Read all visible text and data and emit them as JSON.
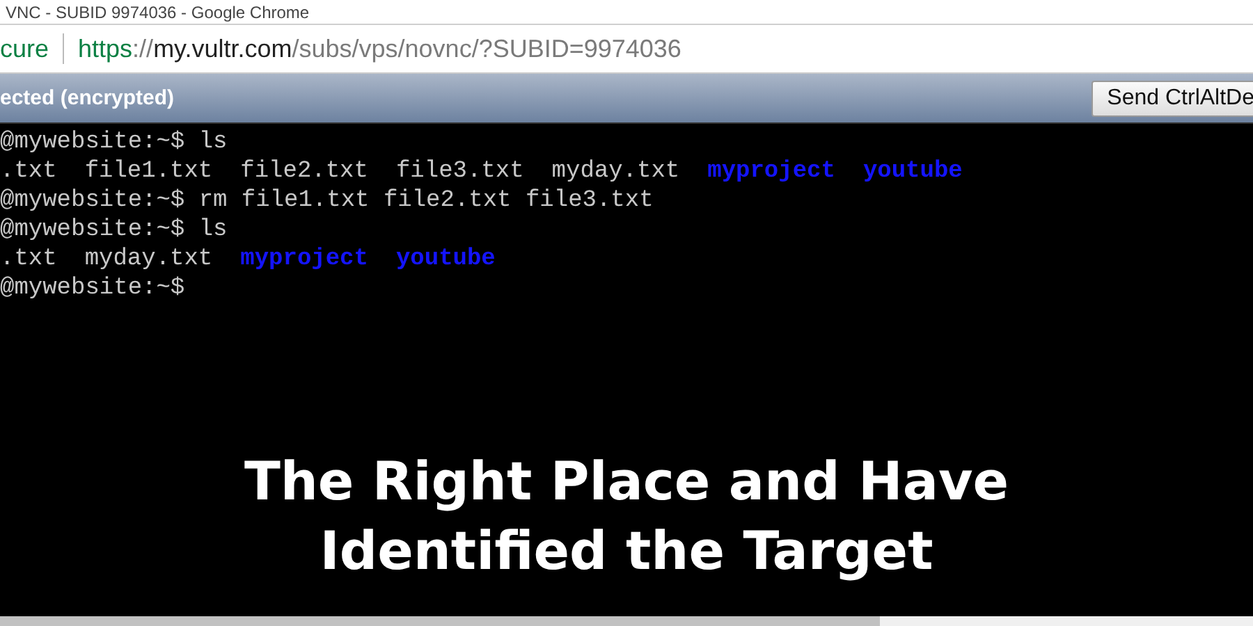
{
  "window": {
    "title": "VNC - SUBID 9974036 - Google Chrome"
  },
  "address_bar": {
    "security": "cure",
    "url_parts": [
      {
        "text": "https",
        "kind": "scheme"
      },
      {
        "text": "://",
        "kind": "path"
      },
      {
        "text": "my.vultr.com",
        "kind": "host"
      },
      {
        "text": "/subs/vps/novnc/?SUBID=9974036",
        "kind": "path"
      }
    ]
  },
  "vnc_bar": {
    "status": "ected (encrypted)",
    "button": "Send CtrlAltDe"
  },
  "terminal": {
    "lines": [
      [
        {
          "text": "@mywebsite:~$ ls",
          "kind": "plain"
        }
      ],
      [
        {
          "text": ".txt",
          "kind": "plain"
        },
        {
          "text": "file1.txt",
          "kind": "plain"
        },
        {
          "text": "file2.txt",
          "kind": "plain"
        },
        {
          "text": "file3.txt",
          "kind": "plain"
        },
        {
          "text": "myday.txt",
          "kind": "plain"
        },
        {
          "text": "myproject",
          "kind": "dir"
        },
        {
          "text": "youtube",
          "kind": "dir"
        }
      ],
      [
        {
          "text": "@mywebsite:~$ rm file1.txt file2.txt file3.txt",
          "kind": "plain"
        }
      ],
      [
        {
          "text": "@mywebsite:~$ ls",
          "kind": "plain"
        }
      ],
      [
        {
          "text": ".txt",
          "kind": "plain"
        },
        {
          "text": "myday.txt",
          "kind": "plain"
        },
        {
          "text": "myproject",
          "kind": "dir"
        },
        {
          "text": "youtube",
          "kind": "dir"
        }
      ],
      [
        {
          "text": "@mywebsite:~$",
          "kind": "plain"
        }
      ]
    ]
  },
  "caption": [
    "The Right Place and Have",
    "Identified the Target"
  ]
}
